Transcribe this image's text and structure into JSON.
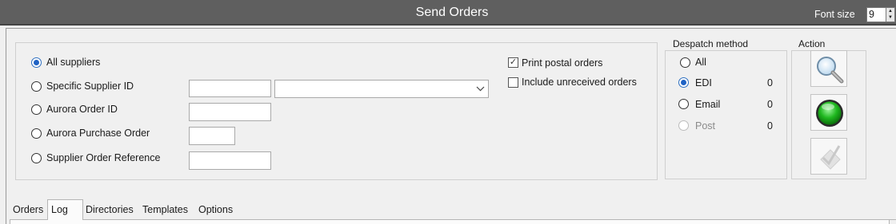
{
  "window": {
    "title": "Send Orders",
    "font_size_label": "Font size",
    "font_size_value": "9"
  },
  "criteria": {
    "options": [
      {
        "label": "All suppliers",
        "selected": true
      },
      {
        "label": "Specific Supplier ID",
        "selected": false
      },
      {
        "label": "Aurora Order ID",
        "selected": false
      },
      {
        "label": "Aurora Purchase Order",
        "selected": false
      },
      {
        "label": "Supplier Order Reference",
        "selected": false
      }
    ],
    "supplier_id_value": "",
    "supplier_dropdown_value": "",
    "aurora_order_id_value": "",
    "aurora_po_value": "",
    "supplier_ref_value": ""
  },
  "checks": {
    "print_postal_orders": {
      "label": "Print postal orders",
      "checked": true
    },
    "include_unreceived": {
      "label": "Include unreceived orders",
      "checked": false
    }
  },
  "despatch": {
    "title": "Despatch method",
    "methods": [
      {
        "label": "All",
        "selected": false,
        "count": ""
      },
      {
        "label": "EDI",
        "selected": true,
        "count": "0"
      },
      {
        "label": "Email",
        "selected": false,
        "count": "0"
      },
      {
        "label": "Post",
        "selected": false,
        "count": "0",
        "disabled": true
      }
    ]
  },
  "action": {
    "title": "Action",
    "buttons": [
      {
        "icon": "magnifier-icon"
      },
      {
        "icon": "green-go-icon"
      },
      {
        "icon": "checkmark-icon",
        "disabled": true
      }
    ]
  },
  "tabs": [
    {
      "label": "Orders"
    },
    {
      "label": "Log",
      "active": true
    },
    {
      "label": "Directories"
    },
    {
      "label": "Templates"
    },
    {
      "label": "Options"
    }
  ],
  "colors": {
    "titlebar": "#5f5f5f",
    "accent_radio": "#1f62c4",
    "go_button": "#1fb81f"
  }
}
